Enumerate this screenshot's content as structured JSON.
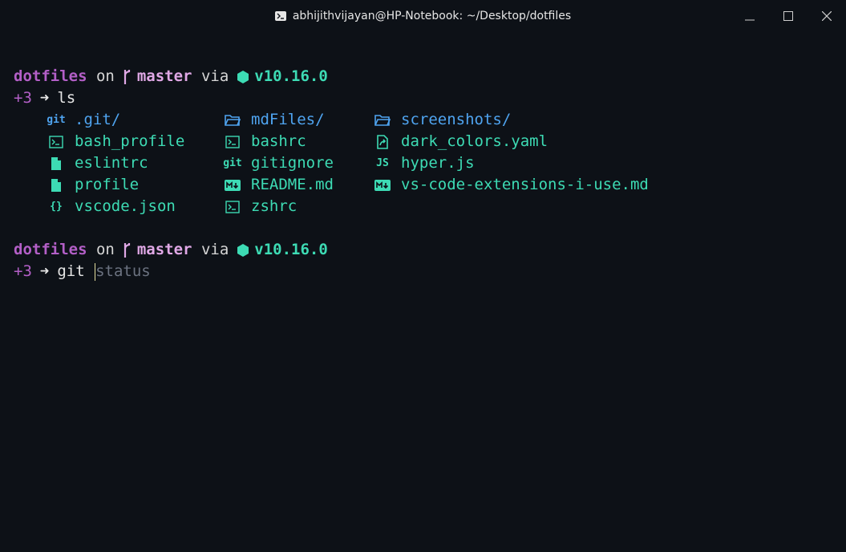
{
  "window": {
    "title": "abhijithvijayan@HP-Notebook: ~/Desktop/dotfiles"
  },
  "prompt1": {
    "dir": "dotfiles",
    "on": "on",
    "branch": "master",
    "via": "via",
    "node_version": "v10.16.0",
    "git_status": "+3",
    "arrow": "➜",
    "command": "ls"
  },
  "ls": {
    "items": [
      {
        "name": ".git/",
        "icon": "git-icon",
        "icon_text": "git",
        "kind": "dir"
      },
      {
        "name": "mdFiles/",
        "icon": "folder-icon",
        "icon_text": "",
        "kind": "dir"
      },
      {
        "name": "screenshots/",
        "icon": "folder-icon",
        "icon_text": "",
        "kind": "dir"
      },
      {
        "name": "bash_profile",
        "icon": "terminal-file-icon",
        "icon_text": "",
        "kind": "file"
      },
      {
        "name": "bashrc",
        "icon": "terminal-file-icon",
        "icon_text": "",
        "kind": "file"
      },
      {
        "name": "dark_colors.yaml",
        "icon": "link-file-icon",
        "icon_text": "",
        "kind": "file"
      },
      {
        "name": "eslintrc",
        "icon": "file-icon",
        "icon_text": "",
        "kind": "file"
      },
      {
        "name": "gitignore",
        "icon": "git-icon",
        "icon_text": "git",
        "kind": "file"
      },
      {
        "name": "hyper.js",
        "icon": "javascript-icon",
        "icon_text": "JS",
        "kind": "file"
      },
      {
        "name": "profile",
        "icon": "file-icon",
        "icon_text": "",
        "kind": "file"
      },
      {
        "name": "README.md",
        "icon": "markdown-icon",
        "icon_text": "",
        "kind": "file"
      },
      {
        "name": "vs-code-extensions-i-use.md",
        "icon": "markdown-icon",
        "icon_text": "",
        "kind": "file"
      },
      {
        "name": "vscode.json",
        "icon": "json-icon",
        "icon_text": "{}",
        "kind": "file"
      },
      {
        "name": "zshrc",
        "icon": "terminal-file-icon",
        "icon_text": "",
        "kind": "file"
      }
    ]
  },
  "prompt2": {
    "dir": "dotfiles",
    "on": "on",
    "branch": "master",
    "via": "via",
    "node_version": "v10.16.0",
    "git_status": "+3",
    "arrow": "➜",
    "command": "git ",
    "suggestion": "status"
  },
  "colors": {
    "background": "#0d1117",
    "dir": "#b35fc7",
    "branch": "#e0a8e6",
    "node": "#3ddbb4",
    "file": "#3ddbb4",
    "folder": "#4fa4f0",
    "suggestion": "#6b7280"
  }
}
